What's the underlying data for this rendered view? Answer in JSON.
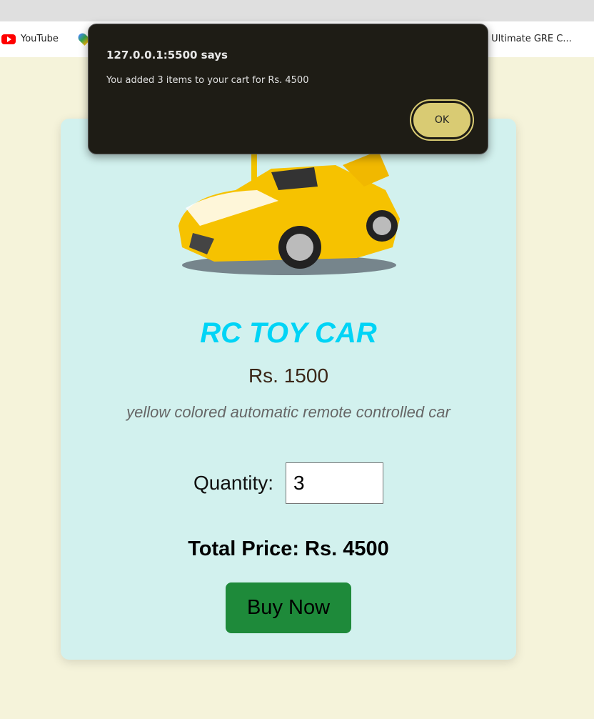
{
  "browser": {
    "bookmarks": [
      {
        "label": "YouTube",
        "icon": "youtube-icon"
      },
      {
        "label": "",
        "icon": "google-maps-icon"
      },
      {
        "label": "e Ultimate GRE C..."
      }
    ]
  },
  "product": {
    "title": "RC TOY CAR",
    "price": "Rs. 1500",
    "description": "yellow colored automatic remote controlled car",
    "quantity_label": "Quantity:",
    "quantity_value": "3",
    "total": "Total Price: Rs. 4500",
    "buy_label": "Buy Now"
  },
  "dialog": {
    "title": "127.0.0.1:5500 says",
    "message": "You added 3 items to your cart for Rs. 4500",
    "ok_label": "OK"
  },
  "colors": {
    "title": "#00d4f6",
    "button": "#1e8a3a",
    "card": "#d2f1ee",
    "page": "#f5f3da"
  }
}
